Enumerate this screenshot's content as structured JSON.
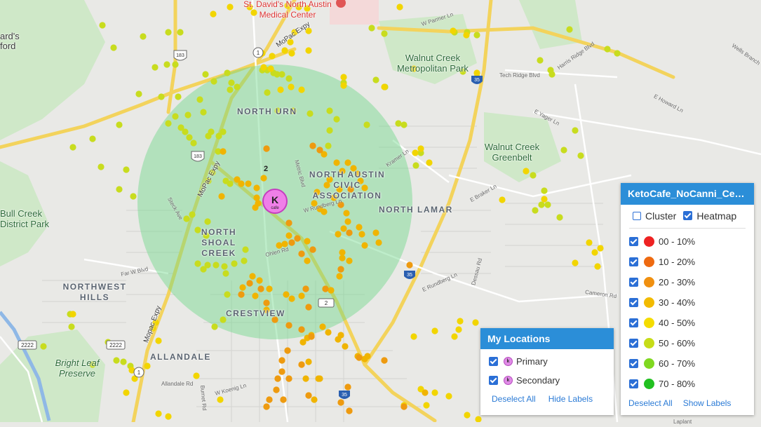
{
  "map": {
    "labels": {
      "hospital": "St. David's North Austin Medical Center",
      "walnut_metro": "Walnut Creek Metropolitan Park",
      "walnut_green": "Walnut Creek Greenbelt",
      "bull_creek": "Bull Creek District Park",
      "bright_leaf": "Bright Leaf Preserve",
      "northwest_hills": "NORTHWEST HILLS",
      "north_burnet": "NORTH URN",
      "north_austin_civic": "NORTH AUSTIN CIVIC ASSOCIATION",
      "north_lamar": "NORTH LAMAR",
      "north_shoal_creek": "NORTH SHOAL CREEK",
      "crestview": "CRESTVIEW",
      "allandale": "ALLANDALE",
      "mopac": "MoPac Expy",
      "mopac2": "Mopac Expy",
      "parmer": "W Parmer Ln",
      "tech_ridge": "Tech Ridge Blvd",
      "braker": "E Braker Ln",
      "rundberg": "E Rundberg Ln",
      "howard": "E Howard Ln",
      "yager": "E Yager Ln",
      "dessau": "Dessau Rd",
      "cameron": "Cameron Rd",
      "harris_ridge": "Harris Ridge Blvd",
      "wells_branch": "Wells Branch",
      "kramer": "Kramer Ln",
      "metric": "Metric Blvd",
      "burnet": "Burnet Rd",
      "koenig": "W Koenig Ln",
      "allandale_rd": "Allandale Rd",
      "far_west": "Far W Blvd",
      "ohlen": "Ohlen Rd",
      "steck": "Steck Ave",
      "rundberg_w": "W Rundberg Ln",
      "shield_183": "183",
      "shield_35": "35",
      "shield_2222": "2222",
      "shield_1": "1",
      "shield_2": "2",
      "cluster_count": "2",
      "ashford": "ard's",
      "ford": "ford",
      "laplant": "Laplant",
      "marker_letter": "K",
      "marker_sub": "cafe"
    },
    "circle_color": "#6ed88a",
    "point_colors": {
      "yellow_green": "#c8dc1e",
      "yellow": "#f2d500",
      "amber": "#f0b400",
      "orange": "#ee9a10"
    }
  },
  "heatmap_panel": {
    "title": "KetoCafe_NoCanni_Cent...",
    "cluster_label": "Cluster",
    "cluster_checked": false,
    "heatmap_label": "Heatmap",
    "heatmap_checked": true,
    "legend": [
      {
        "label": "00 - 10%",
        "color": "#ee2222"
      },
      {
        "label": "10 - 20%",
        "color": "#ee6a10"
      },
      {
        "label": "20 - 30%",
        "color": "#f09010"
      },
      {
        "label": "30 - 40%",
        "color": "#f2bb00"
      },
      {
        "label": "40 - 50%",
        "color": "#f4dc00"
      },
      {
        "label": "50 - 60%",
        "color": "#c6dc18"
      },
      {
        "label": "60 - 70%",
        "color": "#80d820"
      },
      {
        "label": "70 - 80%",
        "color": "#22c020"
      }
    ],
    "deselect_all": "Deselect All",
    "show_labels": "Show Labels"
  },
  "locations_panel": {
    "title": "My Locations",
    "items": [
      {
        "label": "Primary"
      },
      {
        "label": "Secondary"
      }
    ],
    "deselect_all": "Deselect All",
    "hide_labels": "Hide Labels"
  }
}
